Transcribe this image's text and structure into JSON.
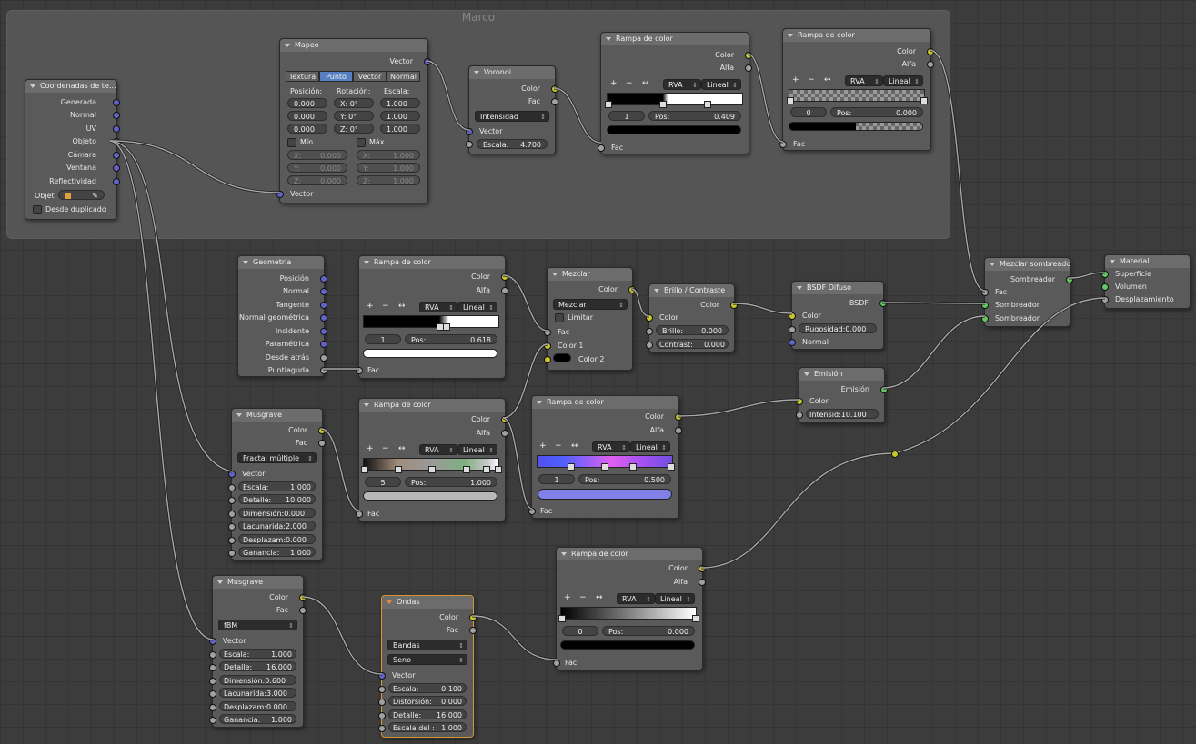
{
  "frame": {
    "title": "Marco"
  },
  "tex_coord": {
    "title": "Coordenadas de te…",
    "outputs": [
      "Generada",
      "Normal",
      "UV",
      "Objeto",
      "Cámara",
      "Ventana",
      "Reflectividad"
    ],
    "object_label": "Objet",
    "dupli_label": "Desde duplicado"
  },
  "mapping": {
    "title": "Mapeo",
    "output": "Vector",
    "tabs": [
      "Textura",
      "Punto",
      "Vector",
      "Normal"
    ],
    "pos_label": "Posición:",
    "rot_label": "Rotación:",
    "scale_label": "Escala:",
    "pos": [
      "0.000",
      "0.000",
      "0.000"
    ],
    "rot": [
      "X:   0°",
      "Y:   0°",
      "Z:   0°"
    ],
    "scale": [
      "1.000",
      "1.000",
      "1.000"
    ],
    "min_label": "Mín",
    "max_label": "Máx",
    "min": [
      "X:",
      "0.000",
      "Y:",
      "0.000",
      "Z:",
      "0.000"
    ],
    "max": [
      "X:",
      "1.000",
      "Y:",
      "1.000",
      "Z:",
      "1.000"
    ],
    "input": "Vector"
  },
  "voronoi": {
    "title": "Voronoi",
    "out_color": "Color",
    "out_fac": "Fac",
    "coloring": "Intensidad",
    "in_vector": "Vector",
    "scale_label": "Escala:",
    "scale": "4.700"
  },
  "ramp1": {
    "title": "Rampa de color",
    "out_color": "Color",
    "out_alpha": "Alfa",
    "mode": "RVA",
    "interp": "Lineal",
    "index": "1",
    "pos_label": "Pos:",
    "pos": "0.409",
    "in_fac": "Fac"
  },
  "ramp2": {
    "title": "Rampa de color",
    "out_color": "Color",
    "out_alpha": "Alfa",
    "mode": "RVA",
    "interp": "Lineal",
    "index": "0",
    "pos_label": "Pos:",
    "pos": "0.000",
    "in_fac": "Fac"
  },
  "geometry": {
    "title": "Geometría",
    "outputs": [
      "Posición",
      "Normal",
      "Tangente",
      "Normal geométrica",
      "Incidente",
      "Paramétrica",
      "Desde atrás",
      "Puntiaguda"
    ]
  },
  "ramp3": {
    "title": "Rampa de color",
    "out_color": "Color",
    "out_alpha": "Alfa",
    "mode": "RVA",
    "interp": "Lineal",
    "index": "1",
    "pos_label": "Pos:",
    "pos": "0.618",
    "in_fac": "Fac"
  },
  "mix": {
    "title": "Mezclar",
    "out_color": "Color",
    "blend": "Mezclar",
    "clamp": "Limitar",
    "in_fac": "Fac",
    "in_c1": "Color 1",
    "in_c2": "Color 2"
  },
  "bright": {
    "title": "Brillo / Contraste",
    "out_color": "Color",
    "in_color": "Color",
    "bright_label": "Brillo:",
    "bright": "0.000",
    "contrast_label": "Contrast:",
    "contrast": "0.000"
  },
  "diffuse": {
    "title": "BSDF Difuso",
    "out": "BSDF",
    "in_color": "Color",
    "rough_label": "Rugosidad:",
    "rough": "0.000",
    "in_normal": "Normal"
  },
  "emission": {
    "title": "Emisión",
    "out": "Emisión",
    "in_color": "Color",
    "strength_label": "Intensid:",
    "strength": "10.100"
  },
  "mixshader": {
    "title": "Mezclar sombreado",
    "out": "Sombreador",
    "in_fac": "Fac",
    "in_s1": "Sombreador",
    "in_s2": "Sombreador"
  },
  "output": {
    "title": "Material",
    "inputs": [
      "Superficie",
      "Volumen",
      "Desplazamiento"
    ]
  },
  "musgrave1": {
    "title": "Musgrave",
    "out_color": "Color",
    "out_fac": "Fac",
    "type": "Fractal múltiple",
    "in_vector": "Vector",
    "fields": [
      [
        "Escala:",
        "1.000"
      ],
      [
        "Detalle:",
        "10.000"
      ],
      [
        "Dimensión:",
        "0.000"
      ],
      [
        "Lacunarida:",
        "2.000"
      ],
      [
        "Desplazam:",
        "0.000"
      ],
      [
        "Ganancia:",
        "1.000"
      ]
    ]
  },
  "ramp4": {
    "title": "Rampa de color",
    "out_color": "Color",
    "out_alpha": "Alfa",
    "mode": "RVA",
    "interp": "Lineal",
    "index": "5",
    "pos_label": "Pos:",
    "pos": "1.000",
    "in_fac": "Fac"
  },
  "ramp5": {
    "title": "Rampa de color",
    "out_color": "Color",
    "out_alpha": "Alfa",
    "mode": "RVA",
    "interp": "Lineal",
    "index": "1",
    "pos_label": "Pos:",
    "pos": "0.500",
    "in_fac": "Fac"
  },
  "musgrave2": {
    "title": "Musgrave",
    "out_color": "Color",
    "out_fac": "Fac",
    "type": "fBM",
    "in_vector": "Vector",
    "fields": [
      [
        "Escala:",
        "1.000"
      ],
      [
        "Detalle:",
        "16.000"
      ],
      [
        "Dimensión:",
        "0.600"
      ],
      [
        "Lacunarida:",
        "3.000"
      ],
      [
        "Desplazam:",
        "0.000"
      ],
      [
        "Ganancia:",
        "1.000"
      ]
    ]
  },
  "wave": {
    "title": "Ondas",
    "out_color": "Color",
    "out_fac": "Fac",
    "type": "Bandas",
    "profile": "Seno",
    "in_vector": "Vector",
    "fields": [
      [
        "Escala:",
        "0.100"
      ],
      [
        "Distorsión:",
        "0.000"
      ],
      [
        "Detalle:",
        "16.000"
      ],
      [
        "Escala del :",
        "1.000"
      ]
    ]
  },
  "ramp6": {
    "title": "Rampa de color",
    "out_color": "Color",
    "out_alpha": "Alfa",
    "mode": "RVA",
    "interp": "Lineal",
    "index": "0",
    "pos_label": "Pos:",
    "pos": "0.000",
    "in_fac": "Fac"
  },
  "ramp_tools": {
    "add": "+",
    "remove": "−",
    "flip": "↔"
  },
  "colors": {
    "socket_color": "#c7c729",
    "socket_float": "#a1a1a1",
    "socket_vector": "#6363c7",
    "socket_shader": "#63c763",
    "active_node": "#d89633"
  }
}
